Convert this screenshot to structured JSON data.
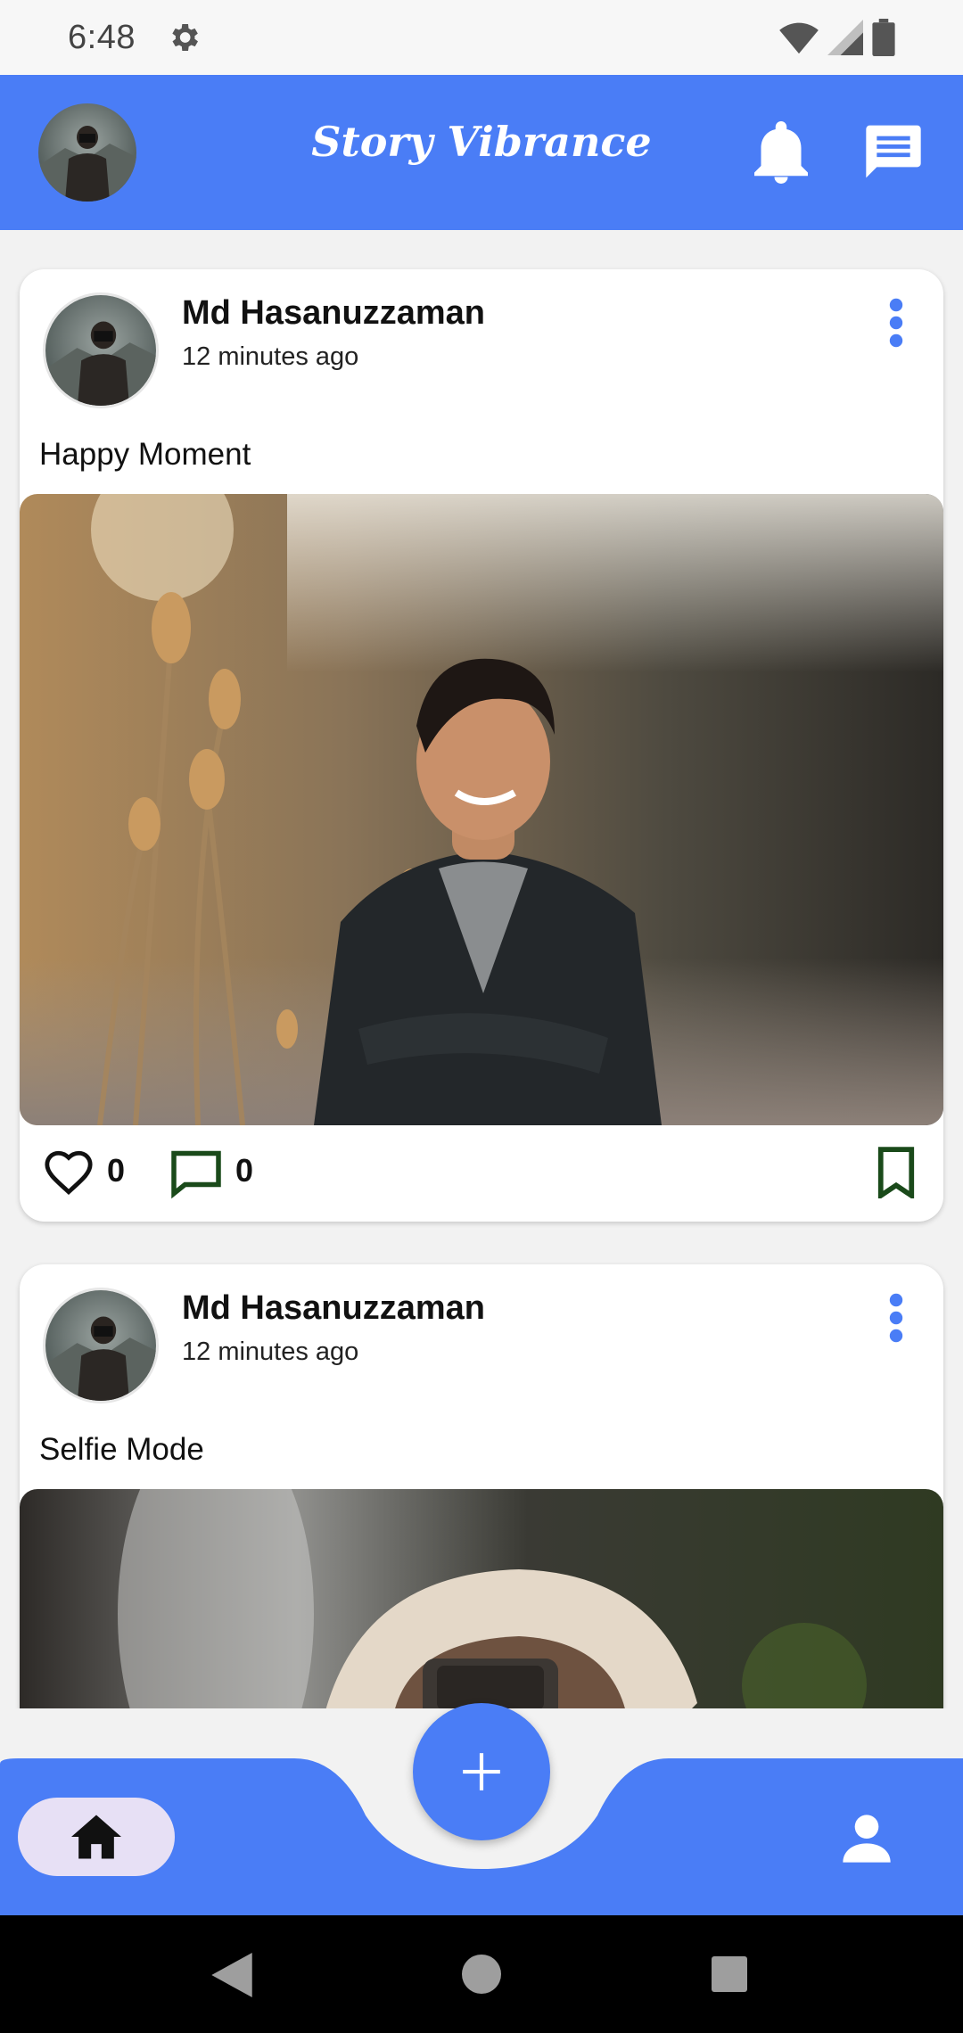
{
  "status_bar": {
    "time": "6:48",
    "icons": [
      "gear-icon",
      "wifi-icon",
      "signal-icon",
      "battery-icon"
    ]
  },
  "app_bar": {
    "title": "Story Vibrance",
    "icons": [
      "avatar",
      "bell-icon",
      "chat-icon"
    ],
    "background": "#4a7df6"
  },
  "posts": [
    {
      "author": "Md Hasanuzzaman",
      "time": "12 minutes ago",
      "caption": "Happy Moment",
      "likes": "0",
      "comments": "0"
    },
    {
      "author": "Md Hasanuzzaman",
      "time": "12 minutes ago",
      "caption": "Selfie Mode"
    }
  ],
  "bottom_nav": {
    "items": [
      "home-icon",
      "add-icon",
      "profile-icon"
    ],
    "active": "home",
    "accent": "#4a7df6",
    "active_pill": "#e7e0f5"
  },
  "system_nav": [
    "back-icon",
    "home-circle-icon",
    "recents-icon"
  ]
}
